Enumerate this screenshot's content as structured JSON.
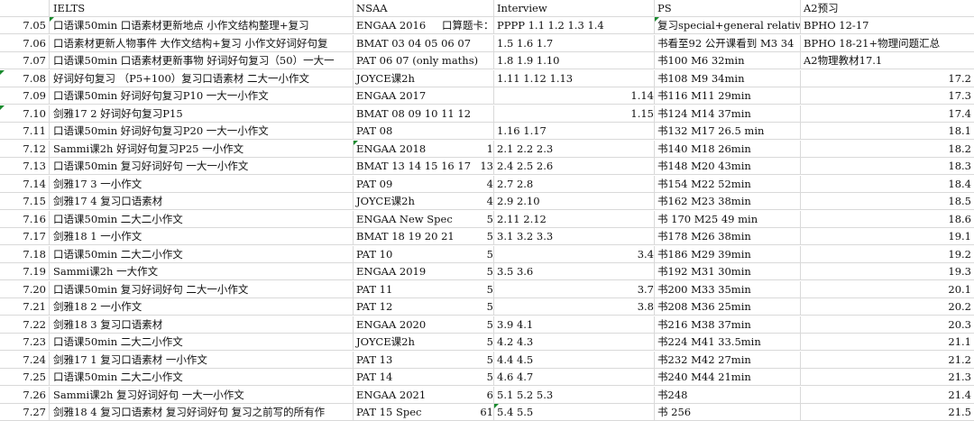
{
  "headers": {
    "date": "",
    "ielts": "IELTS",
    "nsaa": "NSAA",
    "interview": "Interview",
    "ps": "PS",
    "a2": "A2预习"
  },
  "rows": [
    {
      "date": "7.05",
      "ielts": "口语课50min 口语素材更新地点 小作文结构整理+复习",
      "nsaa": "ENGAA 2016",
      "nsaa_extra": "口算题卡：",
      "interview": "PPPP 1.1 1.2 1.3 1.4",
      "ps": "复习special+general relativity",
      "a2": "BPHO 12-17",
      "flag_ielts": true,
      "flag_ps": true
    },
    {
      "date": "7.06",
      "ielts": "口语素材更新人物事件 大作文结构+复习 小作文好词好句复",
      "nsaa": "BMAT 03 04 05 06 07",
      "interview": "1.5 1.6 1.7",
      "ps": "书看至92 公开课看到 M3 34",
      "a2": "BPHO 18-21+物理问题汇总"
    },
    {
      "date": "7.07",
      "ielts": "口语课50min 口语素材更新事物 好词好句复习（50）一大一",
      "nsaa": "PAT 06 07 (only maths)",
      "interview": "1.8 1.9 1.10",
      "ps": "书100 M6 32min",
      "a2": "A2物理教材17.1"
    },
    {
      "date": "7.08",
      "ielts": "好词好句复习 （P5+100）复习口语素材 二大一小作文",
      "nsaa": "JOYCE课2h",
      "interview": "1.11 1.12 1.13",
      "ps": "书108 M9 34min",
      "a2": "17.2",
      "flag_date": true
    },
    {
      "date": "7.09",
      "ielts": "口语课50min 好词好句复习P10 一大一小作文",
      "nsaa": "ENGAA 2017",
      "int_right": "1.14",
      "ps": "书116 M11 29min",
      "a2": "17.3"
    },
    {
      "date": "7.10",
      "ielts": "剑雅17 2 好词好句复习P15",
      "nsaa": "BMAT 08 09 10 11 12",
      "int_right": "1.15",
      "ps": "书124 M14 37min",
      "a2": "17.4",
      "flag_date": true
    },
    {
      "date": "7.11",
      "ielts": "口语课50min 好词好句复习P20 一大一小作文",
      "nsaa": "PAT 08",
      "interview": "1.16 1.17",
      "ps": "书132 M17 26.5 min",
      "a2": "18.1"
    },
    {
      "date": "7.12",
      "ielts": "Sammi课2h 好词好句复习P25 一小作文",
      "nsaa": "ENGAA 2018",
      "nsaa_right": "1",
      "interview": "2.1 2.2 2.3",
      "ps": "书140 M18 26min",
      "a2": "18.2",
      "flag_nsaa": true
    },
    {
      "date": "7.13",
      "ielts": "口语课50min 复习好词好句 一大一小作文",
      "nsaa": "BMAT 13 14 15 16 17",
      "nsaa_right": "13",
      "interview": "2.4 2.5 2.6",
      "ps": "书148 M20 43min",
      "a2": "18.3"
    },
    {
      "date": "7.14",
      "ielts": "剑雅17 3 一小作文",
      "nsaa": "PAT 09",
      "nsaa_right": "4",
      "interview": "2.7 2.8",
      "ps": "书154 M22 52min",
      "a2": "18.4"
    },
    {
      "date": "7.15",
      "ielts": "剑雅17 4 复习口语素材",
      "nsaa": "JOYCE课2h",
      "nsaa_right": "4",
      "interview": "2.9 2.10",
      "ps": "书162 M23 38min",
      "a2": "18.5"
    },
    {
      "date": "7.16",
      "ielts": "口语课50min 二大二小作文",
      "nsaa": "ENGAA New Spec",
      "nsaa_right": "5",
      "interview": "2.11 2.12",
      "ps": "书 170 M25 49 min",
      "a2": "18.6"
    },
    {
      "date": "7.17",
      "ielts": "剑雅18 1 一小作文",
      "nsaa": "BMAT 18 19 20 21",
      "nsaa_right": "5",
      "interview": "3.1 3.2 3.3",
      "ps": "书178 M26 38min",
      "a2": "19.1"
    },
    {
      "date": "7.18",
      "ielts": "口语课50min 二大二小作文",
      "nsaa": "PAT 10",
      "nsaa_right": "5",
      "int_right": "3.4",
      "ps": "书186 M29 39min",
      "a2": "19.2"
    },
    {
      "date": "7.19",
      "ielts": "Sammi课2h 一大作文",
      "nsaa": "ENGAA 2019",
      "nsaa_right": "5",
      "interview": "3.5 3.6",
      "ps": "书192 M31 30min",
      "a2": "19.3"
    },
    {
      "date": "7.20",
      "ielts": "口语课50min 复习好词好句 二大一小作文",
      "nsaa": "PAT 11",
      "nsaa_right": "5",
      "int_right": "3.7",
      "ps": "书200 M33 35min",
      "a2": "20.1"
    },
    {
      "date": "7.21",
      "ielts": "剑雅18 2 一小作文",
      "nsaa": "PAT 12",
      "nsaa_right": "5",
      "int_right": "3.8",
      "ps": "书208 M36 25min",
      "a2": "20.2"
    },
    {
      "date": "7.22",
      "ielts": "剑雅18 3 复习口语素材",
      "nsaa": "ENGAA 2020",
      "nsaa_right": "5",
      "interview": "3.9 4.1",
      "ps": "书216 M38 37min",
      "a2": "20.3"
    },
    {
      "date": "7.23",
      "ielts": "口语课50min 二大二小作文",
      "nsaa": "JOYCE课2h",
      "nsaa_right": "5",
      "interview": "4.2 4.3",
      "ps": "书224 M41 33.5min",
      "a2": "21.1"
    },
    {
      "date": "7.24",
      "ielts": "剑雅17 1 复习口语素材 一小作文",
      "nsaa": "PAT 13",
      "nsaa_right": "5",
      "interview": "4.4 4.5",
      "ps": "书232 M42 27min",
      "a2": "21.2"
    },
    {
      "date": "7.25",
      "ielts": "口语课50min 二大二小作文",
      "nsaa": "PAT 14",
      "nsaa_right": "5",
      "interview": "4.6 4.7",
      "ps": "书240 M44 21min",
      "a2": "21.3"
    },
    {
      "date": "7.26",
      "ielts": "Sammi课2h 复习好词好句 一大一小作文",
      "nsaa": "ENGAA 2021",
      "nsaa_right": "6",
      "interview": "5.1 5.2 5.3",
      "ps": "书248",
      "a2": "21.4"
    },
    {
      "date": "7.27",
      "ielts": "剑雅18 4 复习口语素材 复习好词好句 复习之前写的所有作",
      "nsaa": "PAT 15 Spec",
      "nsaa_right": "61",
      "interview": "5.4 5.5",
      "ps": "书 256",
      "a2": "21.5",
      "flag_int": true
    }
  ]
}
